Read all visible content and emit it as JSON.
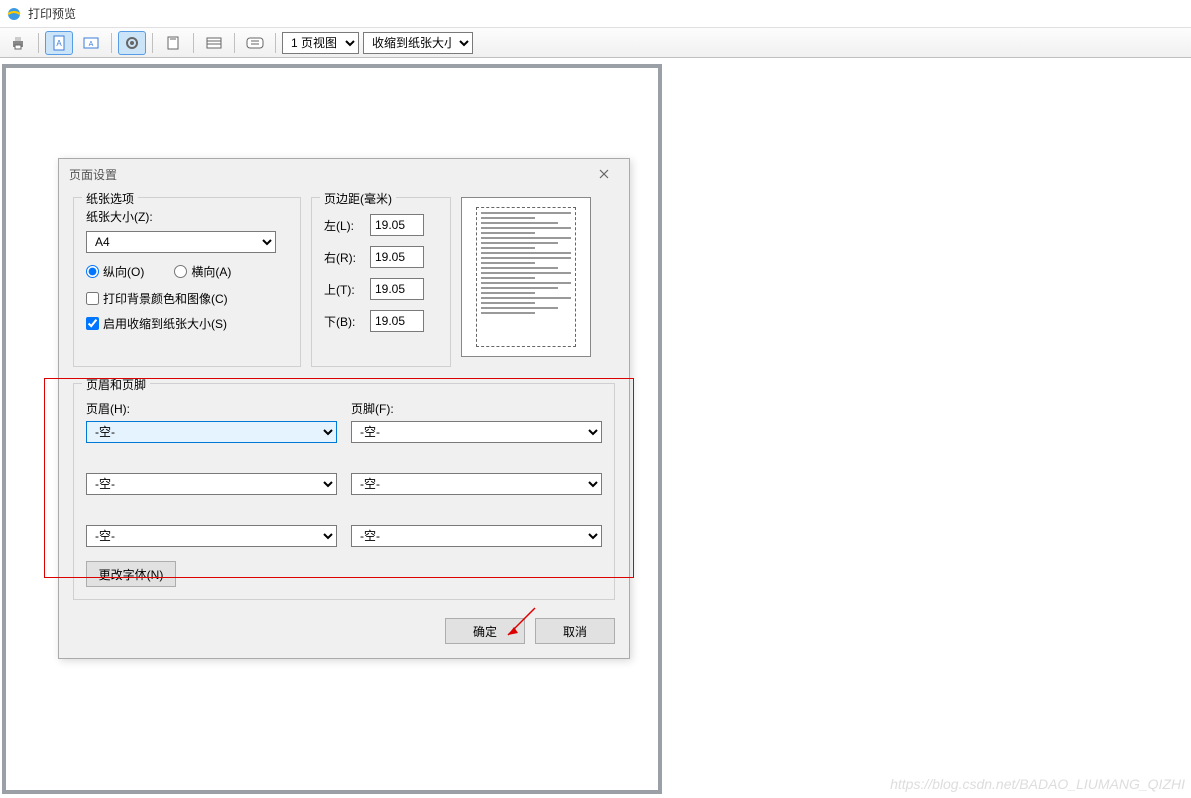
{
  "window": {
    "title": "打印预览"
  },
  "toolbar": {
    "page_view_select": "1 页视图",
    "zoom_select": "收缩到纸张大小"
  },
  "dialog": {
    "title": "页面设置",
    "paper": {
      "legend": "纸张选项",
      "size_label": "纸张大小(Z):",
      "size_value": "A4",
      "orient_portrait": "纵向(O)",
      "orient_landscape": "横向(A)",
      "print_bg": "打印背景颜色和图像(C)",
      "shrink": "启用收缩到纸张大小(S)"
    },
    "margins": {
      "legend": "页边距(毫米)",
      "left_label": "左(L):",
      "right_label": "右(R):",
      "top_label": "上(T):",
      "bottom_label": "下(B):",
      "left": "19.05",
      "right": "19.05",
      "top": "19.05",
      "bottom": "19.05"
    },
    "header_footer": {
      "legend": "页眉和页脚",
      "header_label": "页眉(H):",
      "footer_label": "页脚(F):",
      "empty_option": "-空-",
      "h1": "-空-",
      "h2": "-空-",
      "h3": "-空-",
      "f1": "-空-",
      "f2": "-空-",
      "f3": "-空-",
      "font_btn": "更改字体(N)"
    },
    "buttons": {
      "ok": "确定",
      "cancel": "取消"
    }
  },
  "watermark": "https://blog.csdn.net/BADAO_LIUMANG_QIZHI"
}
